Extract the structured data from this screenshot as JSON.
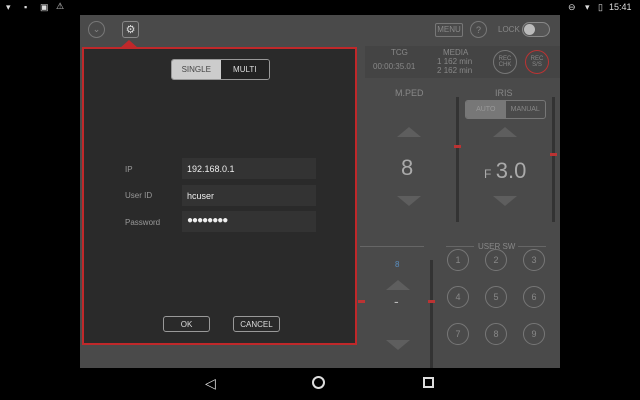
{
  "status_bar": {
    "time": "15:41",
    "icons": [
      "wifi-question-icon",
      "image-icon",
      "photo-icon",
      "warning-icon",
      "dnd-icon",
      "wifi-icon",
      "battery-icon"
    ]
  },
  "toolbar": {
    "menu_label": "MENU",
    "help_label": "?",
    "lock_label": "LOCK",
    "lock_on": false
  },
  "info": {
    "tcg_label": "TCG",
    "tcg_value": "00:00:35.01",
    "media_label": "MEDIA",
    "media1": "162 min",
    "media2": "162 min",
    "slot1": "1",
    "slot2": "2",
    "rec_chk": "REC CHK",
    "rec_ss": "REC S/S"
  },
  "mped": {
    "label": "M.PED",
    "value": "8"
  },
  "iris": {
    "label": "IRIS",
    "auto": "AUTO",
    "manual": "MANUAL",
    "prefix": "F",
    "value": "3.0"
  },
  "lower": {
    "small_value": "8",
    "dash": "-"
  },
  "user_sw": {
    "label": "USER SW",
    "buttons": [
      "1",
      "2",
      "3",
      "4",
      "5",
      "6",
      "7",
      "8",
      "9"
    ]
  },
  "dialog": {
    "mode_single": "SINGLE",
    "mode_multi": "MULTI",
    "selected_mode": "SINGLE",
    "ip_label": "IP",
    "ip_value": "192.168.0.1",
    "user_label": "User ID",
    "user_value": "hcuser",
    "password_label": "Password",
    "password_value": "●●●●●●●●",
    "ok": "OK",
    "cancel": "CANCEL"
  },
  "accent": "#c0282a"
}
